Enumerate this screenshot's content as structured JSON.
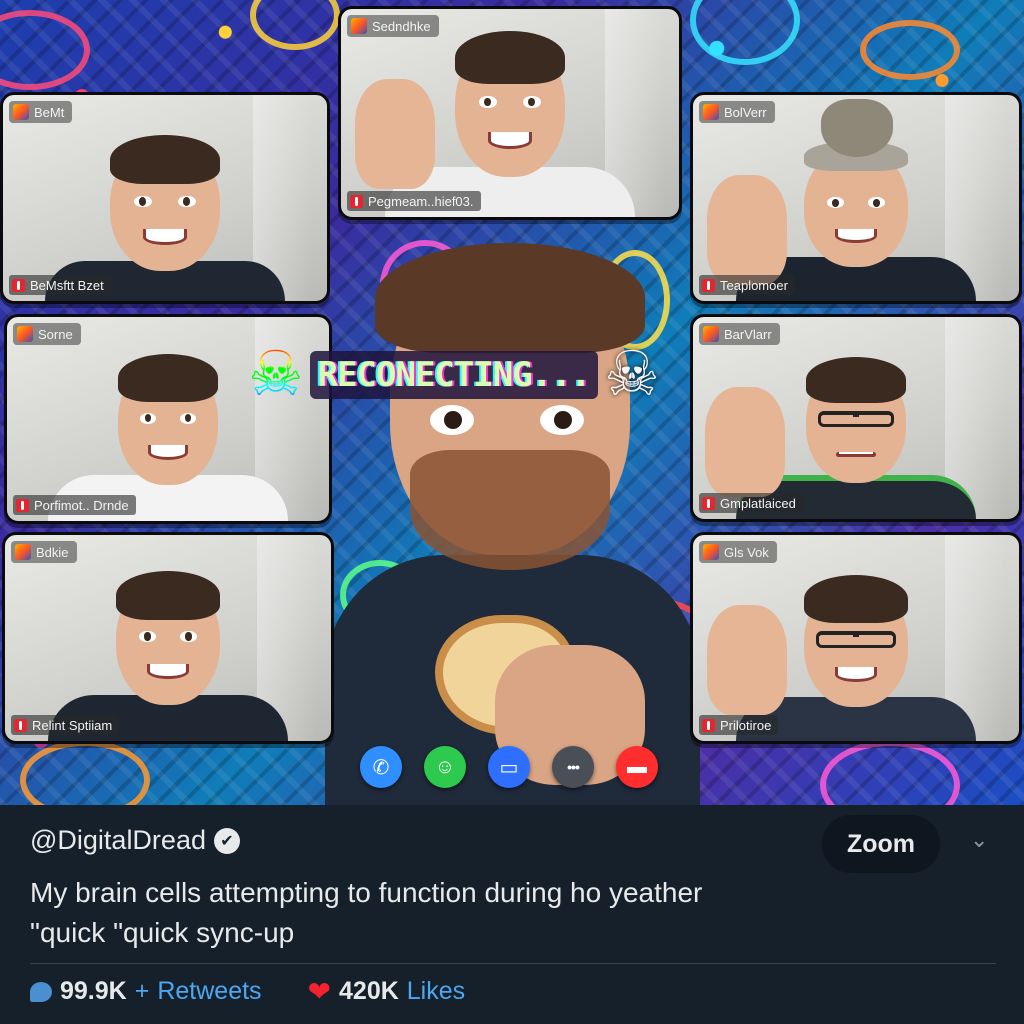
{
  "call": {
    "tiles": [
      {
        "id": "t1",
        "top_label": "BeMt",
        "bottom_label": "BeMsftt Bzet"
      },
      {
        "id": "t2",
        "top_label": "Sedndhke",
        "bottom_label": "Pegmeam..hief03."
      },
      {
        "id": "t3",
        "top_label": "BolVerr",
        "bottom_label": "Teaplomoer"
      },
      {
        "id": "t4",
        "top_label": "Sorne",
        "bottom_label": "Porfimot.. Drnde"
      },
      {
        "id": "t5",
        "top_label": "BarVlarr",
        "bottom_label": "Gmplatlaiced"
      },
      {
        "id": "t6",
        "top_label": "Bdkie",
        "bottom_label": "Relint Sptiiam"
      },
      {
        "id": "t7",
        "top_label": "Gls Vok",
        "bottom_label": "Prilotiroe"
      }
    ],
    "status_text": "RECONECTING...",
    "controls": [
      {
        "icon": "phone-icon",
        "glyph": "✆",
        "color": "#2f8fff"
      },
      {
        "icon": "smiley-icon",
        "glyph": "☺",
        "color": "#2ec94f"
      },
      {
        "icon": "chat-icon",
        "glyph": "▭",
        "color": "#2f6fff"
      },
      {
        "icon": "more-icon",
        "glyph": "•••",
        "color": "#4a4f57"
      },
      {
        "icon": "end-call-icon",
        "glyph": "▬",
        "color": "#ff2d2d"
      }
    ]
  },
  "tweet": {
    "handle": "@DigitalDread",
    "verified_glyph": "✔",
    "zoom_label": "Zoom",
    "chevron": "⌄",
    "text_line1": "My brain cells attempting to function during ho yeather",
    "text_line2": "\"quick \"quick sync-up",
    "replies": "99.9K",
    "plus": "+",
    "retweets_label": "Retweets",
    "likes": "420K",
    "likes_label": "Likes"
  }
}
